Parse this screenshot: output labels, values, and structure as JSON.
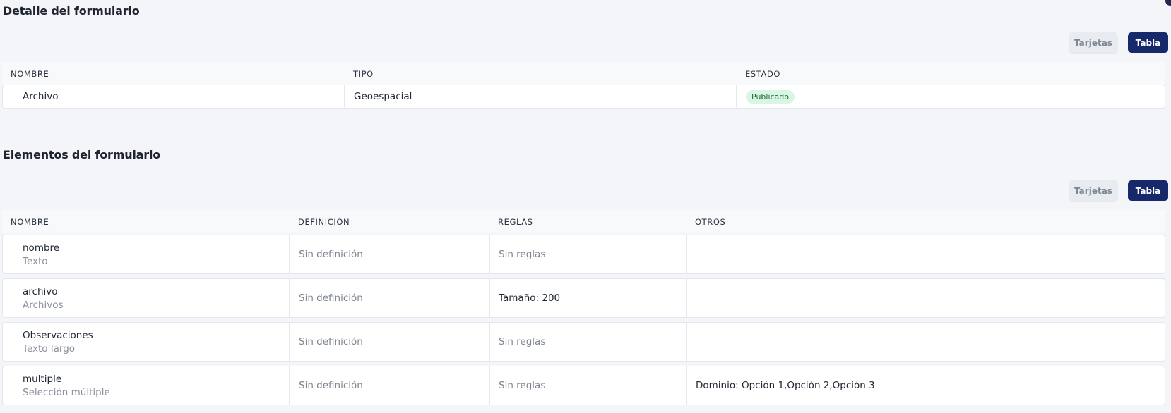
{
  "detail": {
    "title": "Detalle del formulario",
    "view_toggle": {
      "cards_label": "Tarjetas",
      "table_label": "Tabla"
    },
    "columns": [
      "NOMBRE",
      "TIPO",
      "ESTADO"
    ],
    "row": {
      "name": "Archivo",
      "type": "Geoespacial",
      "status": "Publicado"
    }
  },
  "elements": {
    "title": "Elementos del formulario",
    "view_toggle": {
      "cards_label": "Tarjetas",
      "table_label": "Tabla"
    },
    "columns": [
      "NOMBRE",
      "DEFINICIÓN",
      "REGLAS",
      "OTROS"
    ],
    "rows": [
      {
        "name": "nombre",
        "type": "Texto",
        "definition": "Sin definición",
        "rules": "Sin reglas",
        "others": ""
      },
      {
        "name": "archivo",
        "type": "Archivos",
        "definition": "Sin definición",
        "rules": "Tamaño: 200",
        "others": ""
      },
      {
        "name": "Observaciones",
        "type": "Texto largo",
        "definition": "Sin definición",
        "rules": "Sin reglas",
        "others": ""
      },
      {
        "name": "multiple",
        "type": "Selección múltiple",
        "definition": "Sin definición",
        "rules": "Sin reglas",
        "others": "Dominio: Opción 1,Opción 2,Opción 3"
      }
    ]
  },
  "colors": {
    "background": "#f3f5f8",
    "primary_button": "#17296b",
    "status_badge_bg": "#d9f5e3",
    "status_badge_text": "#1f6b3d"
  }
}
